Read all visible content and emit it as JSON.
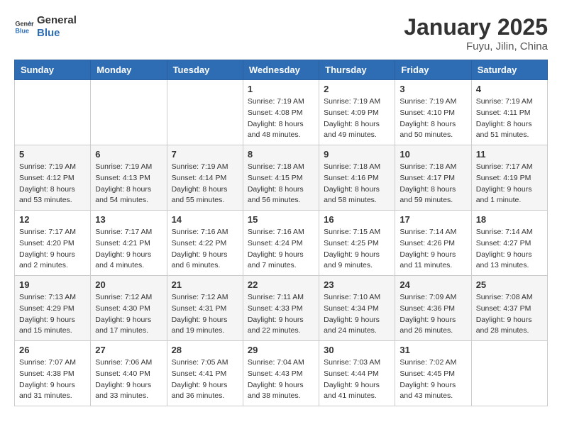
{
  "logo": {
    "text_general": "General",
    "text_blue": "Blue"
  },
  "title": "January 2025",
  "location": "Fuyu, Jilin, China",
  "days_header": [
    "Sunday",
    "Monday",
    "Tuesday",
    "Wednesday",
    "Thursday",
    "Friday",
    "Saturday"
  ],
  "weeks": [
    [
      {
        "day": "",
        "sunrise": "",
        "sunset": "",
        "daylight": ""
      },
      {
        "day": "",
        "sunrise": "",
        "sunset": "",
        "daylight": ""
      },
      {
        "day": "",
        "sunrise": "",
        "sunset": "",
        "daylight": ""
      },
      {
        "day": "1",
        "sunrise": "Sunrise: 7:19 AM",
        "sunset": "Sunset: 4:08 PM",
        "daylight": "Daylight: 8 hours and 48 minutes."
      },
      {
        "day": "2",
        "sunrise": "Sunrise: 7:19 AM",
        "sunset": "Sunset: 4:09 PM",
        "daylight": "Daylight: 8 hours and 49 minutes."
      },
      {
        "day": "3",
        "sunrise": "Sunrise: 7:19 AM",
        "sunset": "Sunset: 4:10 PM",
        "daylight": "Daylight: 8 hours and 50 minutes."
      },
      {
        "day": "4",
        "sunrise": "Sunrise: 7:19 AM",
        "sunset": "Sunset: 4:11 PM",
        "daylight": "Daylight: 8 hours and 51 minutes."
      }
    ],
    [
      {
        "day": "5",
        "sunrise": "Sunrise: 7:19 AM",
        "sunset": "Sunset: 4:12 PM",
        "daylight": "Daylight: 8 hours and 53 minutes."
      },
      {
        "day": "6",
        "sunrise": "Sunrise: 7:19 AM",
        "sunset": "Sunset: 4:13 PM",
        "daylight": "Daylight: 8 hours and 54 minutes."
      },
      {
        "day": "7",
        "sunrise": "Sunrise: 7:19 AM",
        "sunset": "Sunset: 4:14 PM",
        "daylight": "Daylight: 8 hours and 55 minutes."
      },
      {
        "day": "8",
        "sunrise": "Sunrise: 7:18 AM",
        "sunset": "Sunset: 4:15 PM",
        "daylight": "Daylight: 8 hours and 56 minutes."
      },
      {
        "day": "9",
        "sunrise": "Sunrise: 7:18 AM",
        "sunset": "Sunset: 4:16 PM",
        "daylight": "Daylight: 8 hours and 58 minutes."
      },
      {
        "day": "10",
        "sunrise": "Sunrise: 7:18 AM",
        "sunset": "Sunset: 4:17 PM",
        "daylight": "Daylight: 8 hours and 59 minutes."
      },
      {
        "day": "11",
        "sunrise": "Sunrise: 7:17 AM",
        "sunset": "Sunset: 4:19 PM",
        "daylight": "Daylight: 9 hours and 1 minute."
      }
    ],
    [
      {
        "day": "12",
        "sunrise": "Sunrise: 7:17 AM",
        "sunset": "Sunset: 4:20 PM",
        "daylight": "Daylight: 9 hours and 2 minutes."
      },
      {
        "day": "13",
        "sunrise": "Sunrise: 7:17 AM",
        "sunset": "Sunset: 4:21 PM",
        "daylight": "Daylight: 9 hours and 4 minutes."
      },
      {
        "day": "14",
        "sunrise": "Sunrise: 7:16 AM",
        "sunset": "Sunset: 4:22 PM",
        "daylight": "Daylight: 9 hours and 6 minutes."
      },
      {
        "day": "15",
        "sunrise": "Sunrise: 7:16 AM",
        "sunset": "Sunset: 4:24 PM",
        "daylight": "Daylight: 9 hours and 7 minutes."
      },
      {
        "day": "16",
        "sunrise": "Sunrise: 7:15 AM",
        "sunset": "Sunset: 4:25 PM",
        "daylight": "Daylight: 9 hours and 9 minutes."
      },
      {
        "day": "17",
        "sunrise": "Sunrise: 7:14 AM",
        "sunset": "Sunset: 4:26 PM",
        "daylight": "Daylight: 9 hours and 11 minutes."
      },
      {
        "day": "18",
        "sunrise": "Sunrise: 7:14 AM",
        "sunset": "Sunset: 4:27 PM",
        "daylight": "Daylight: 9 hours and 13 minutes."
      }
    ],
    [
      {
        "day": "19",
        "sunrise": "Sunrise: 7:13 AM",
        "sunset": "Sunset: 4:29 PM",
        "daylight": "Daylight: 9 hours and 15 minutes."
      },
      {
        "day": "20",
        "sunrise": "Sunrise: 7:12 AM",
        "sunset": "Sunset: 4:30 PM",
        "daylight": "Daylight: 9 hours and 17 minutes."
      },
      {
        "day": "21",
        "sunrise": "Sunrise: 7:12 AM",
        "sunset": "Sunset: 4:31 PM",
        "daylight": "Daylight: 9 hours and 19 minutes."
      },
      {
        "day": "22",
        "sunrise": "Sunrise: 7:11 AM",
        "sunset": "Sunset: 4:33 PM",
        "daylight": "Daylight: 9 hours and 22 minutes."
      },
      {
        "day": "23",
        "sunrise": "Sunrise: 7:10 AM",
        "sunset": "Sunset: 4:34 PM",
        "daylight": "Daylight: 9 hours and 24 minutes."
      },
      {
        "day": "24",
        "sunrise": "Sunrise: 7:09 AM",
        "sunset": "Sunset: 4:36 PM",
        "daylight": "Daylight: 9 hours and 26 minutes."
      },
      {
        "day": "25",
        "sunrise": "Sunrise: 7:08 AM",
        "sunset": "Sunset: 4:37 PM",
        "daylight": "Daylight: 9 hours and 28 minutes."
      }
    ],
    [
      {
        "day": "26",
        "sunrise": "Sunrise: 7:07 AM",
        "sunset": "Sunset: 4:38 PM",
        "daylight": "Daylight: 9 hours and 31 minutes."
      },
      {
        "day": "27",
        "sunrise": "Sunrise: 7:06 AM",
        "sunset": "Sunset: 4:40 PM",
        "daylight": "Daylight: 9 hours and 33 minutes."
      },
      {
        "day": "28",
        "sunrise": "Sunrise: 7:05 AM",
        "sunset": "Sunset: 4:41 PM",
        "daylight": "Daylight: 9 hours and 36 minutes."
      },
      {
        "day": "29",
        "sunrise": "Sunrise: 7:04 AM",
        "sunset": "Sunset: 4:43 PM",
        "daylight": "Daylight: 9 hours and 38 minutes."
      },
      {
        "day": "30",
        "sunrise": "Sunrise: 7:03 AM",
        "sunset": "Sunset: 4:44 PM",
        "daylight": "Daylight: 9 hours and 41 minutes."
      },
      {
        "day": "31",
        "sunrise": "Sunrise: 7:02 AM",
        "sunset": "Sunset: 4:45 PM",
        "daylight": "Daylight: 9 hours and 43 minutes."
      },
      {
        "day": "",
        "sunrise": "",
        "sunset": "",
        "daylight": ""
      }
    ]
  ]
}
